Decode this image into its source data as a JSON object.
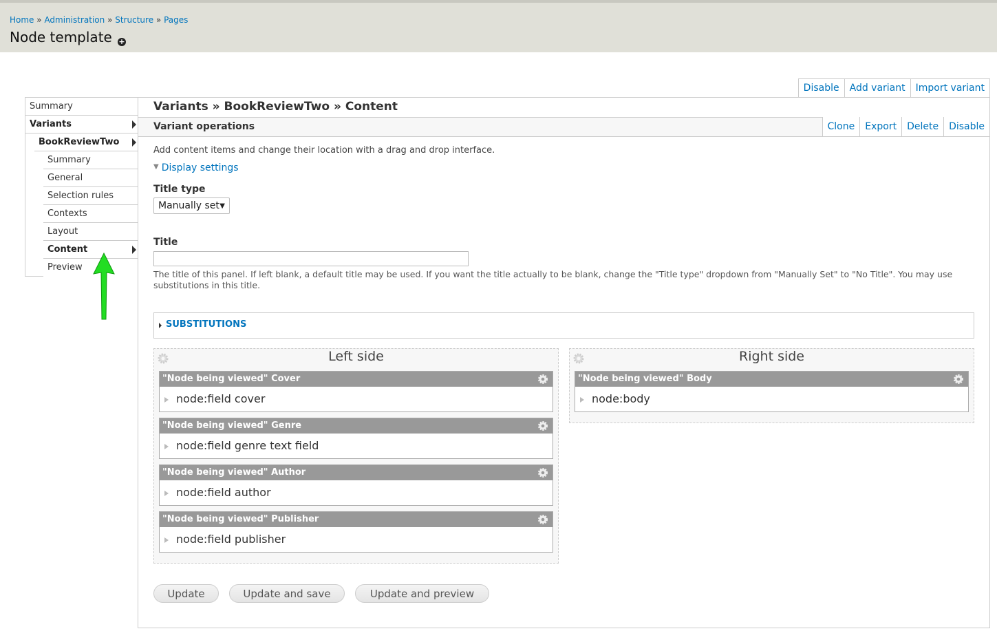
{
  "header": {
    "breadcrumb": [
      "Home",
      "Administration",
      "Structure",
      "Pages"
    ],
    "breadcrumb_separator": "»",
    "title": "Node template"
  },
  "page_actions": [
    "Disable",
    "Add variant",
    "Import variant"
  ],
  "left_nav": {
    "items": [
      {
        "label": "Summary"
      },
      {
        "label": "Variants"
      },
      {
        "label": "BookReviewTwo"
      },
      {
        "label": "Summary"
      },
      {
        "label": "General"
      },
      {
        "label": "Selection rules"
      },
      {
        "label": "Contexts"
      },
      {
        "label": "Layout"
      },
      {
        "label": "Content"
      },
      {
        "label": "Preview"
      }
    ]
  },
  "main": {
    "title": "Variants » BookReviewTwo » Content",
    "operations_label": "Variant operations",
    "operations": [
      "Clone",
      "Export",
      "Delete",
      "Disable"
    ],
    "description": "Add content items and change their location with a drag and drop interface.",
    "display_settings": "Display settings",
    "title_type_label": "Title type",
    "title_type_value": "Manually set",
    "title_label": "Title",
    "title_value": "",
    "title_help": "The title of this panel. If left blank, a default title may be used. If you want the title actually to be blank, change the \"Title type\" dropdown from \"Manually Set\" to \"No Title\". You may use substitutions in this title.",
    "substitutions": "SUBSTITUTIONS"
  },
  "regions": {
    "left": {
      "title": "Left side",
      "panes": [
        {
          "head": "\"Node being viewed\" Cover",
          "body": "node:field cover"
        },
        {
          "head": "\"Node being viewed\" Genre",
          "body": "node:field genre text field"
        },
        {
          "head": "\"Node being viewed\" Author",
          "body": "node:field author"
        },
        {
          "head": "\"Node being viewed\" Publisher",
          "body": "node:field publisher"
        }
      ]
    },
    "right": {
      "title": "Right side",
      "panes": [
        {
          "head": "\"Node being viewed\" Body",
          "body": "node:body"
        }
      ]
    }
  },
  "buttons": {
    "update": "Update",
    "update_save": "Update and save",
    "update_preview": "Update and preview"
  },
  "colors": {
    "link": "#0074bd",
    "header_bg": "#e0e0d8",
    "pane_head": "#999999",
    "annotation_arrow": "#22dd22"
  }
}
